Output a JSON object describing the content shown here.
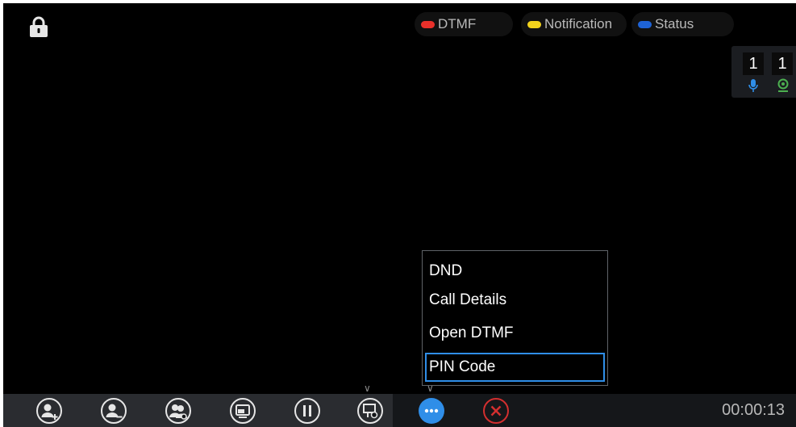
{
  "legend": {
    "dtmf": {
      "label": "DTMF",
      "color": "#e8302a"
    },
    "notification": {
      "label": "Notification",
      "color": "#f2d21c"
    },
    "status": {
      "label": "Status",
      "color": "#1e63d6"
    }
  },
  "stats": {
    "audio_count": "1",
    "video_count": "1",
    "audio_icon": "microphone-icon",
    "video_icon": "webcam-icon"
  },
  "menu": {
    "items": [
      "DND",
      "Call Details",
      "Open DTMF",
      "PIN Code"
    ],
    "selected": "PIN Code"
  },
  "toolbar": {
    "icons": [
      "add-participant-icon",
      "remove-participant-icon",
      "participants-icon",
      "layout-icon",
      "pause-icon",
      "screen-share-icon",
      "more-icon",
      "end-call-icon"
    ],
    "timer": "00:00:13",
    "accent": "#2f8ee8",
    "end_call_color": "#d32f2f"
  },
  "lock_icon": "lock-icon"
}
